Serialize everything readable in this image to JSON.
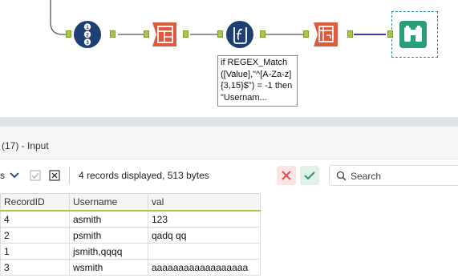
{
  "workflow": {
    "tools": [
      {
        "name": "Record ID",
        "icon": "record-id-icon",
        "color": "#1e3f73"
      },
      {
        "name": "Transpose",
        "icon": "transpose-icon",
        "color": "#dd5a3c"
      },
      {
        "name": "Formula",
        "icon": "formula-icon",
        "color": "#1e3f73"
      },
      {
        "name": "Cross Tab",
        "icon": "crosstab-icon",
        "color": "#dd5a3c"
      },
      {
        "name": "Browse",
        "icon": "binoculars-icon",
        "color": "#2a9d7a"
      }
    ],
    "annotation": "if REGEX_Match ([Value],\"^[A-Za-z]{3,15}$\") = -1 then \"Usernam..."
  },
  "results": {
    "title": "(17) - Input",
    "view_label": "s",
    "records_text": "4 records displayed, 513 bytes",
    "search_placeholder": "Search",
    "columns": [
      "RecordID",
      "Username",
      "val"
    ],
    "rows": [
      [
        "4",
        "asmith",
        "123"
      ],
      [
        "2",
        "psmith",
        "qadq qq"
      ],
      [
        "1",
        "jsmith,qqqq",
        ""
      ],
      [
        "3",
        "wsmith",
        "aaaaaaaaaaaaaaaaaa"
      ]
    ]
  },
  "colors": {
    "accent": "#a8c64a",
    "connection_selected": "#3d3f9e",
    "cancel": "#e05050",
    "confirm": "#2f9a62"
  }
}
